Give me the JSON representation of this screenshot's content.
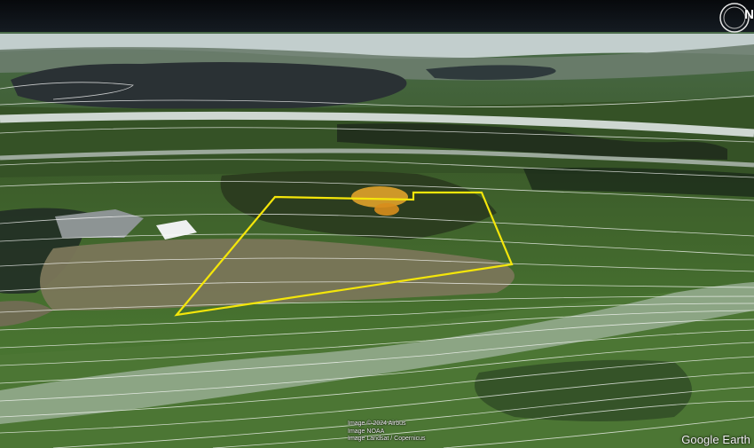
{
  "app": {
    "brand": "Google Earth"
  },
  "compass": {
    "letter": "N",
    "icon": "compass-ring-icon"
  },
  "attribution": [
    "Image © 2024 Airbus",
    "Image NOAA",
    "Image Landsat / Copernicus"
  ],
  "colors": {
    "sky": "#0b1016",
    "water": "#2a3134",
    "vegetation": "#3f6a2c",
    "field": "#7a7659",
    "road": "#c8c8c8",
    "contour": "#ffffff",
    "parcel_outline": "#f4e60a",
    "autumn_tree": "#e0a22a"
  }
}
